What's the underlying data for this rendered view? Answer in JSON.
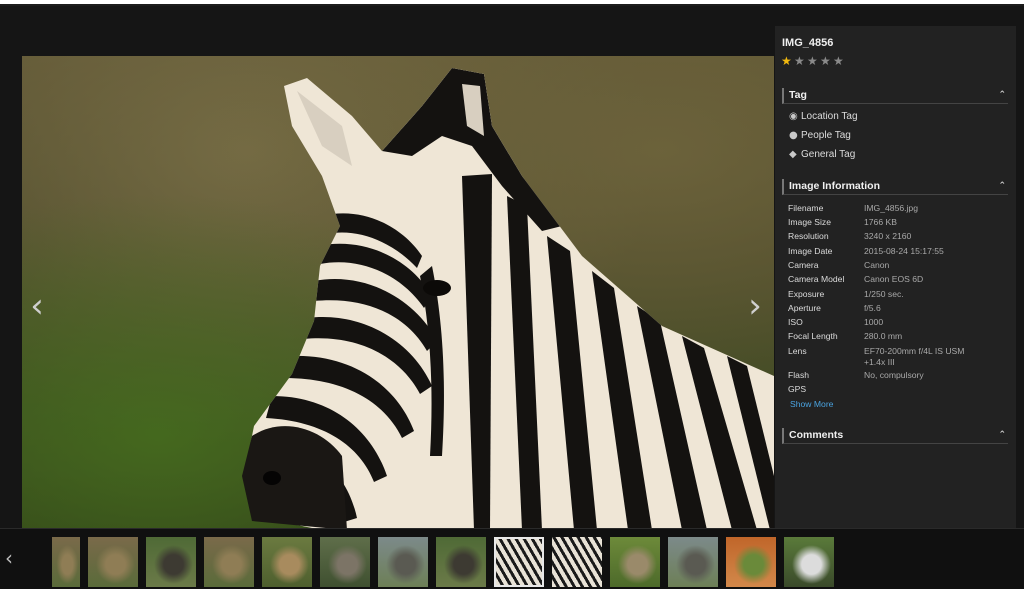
{
  "viewer": {
    "title": "IMG_4856",
    "rating": 1,
    "rating_max": 5
  },
  "tag_section": {
    "heading": "Tag",
    "items": [
      {
        "label": "Location Tag",
        "icon": "location-pin-icon"
      },
      {
        "label": "People Tag",
        "icon": "person-icon"
      },
      {
        "label": "General Tag",
        "icon": "tag-icon"
      }
    ]
  },
  "info_section": {
    "heading": "Image Information",
    "rows": [
      {
        "key": "Filename",
        "value": "IMG_4856.jpg"
      },
      {
        "key": "Image Size",
        "value": "1766 KB"
      },
      {
        "key": "Resolution",
        "value": "3240 x 2160"
      },
      {
        "key": "Image Date",
        "value": "2015-08-24 15:17:55"
      },
      {
        "key": "Camera",
        "value": "Canon"
      },
      {
        "key": "Camera Model",
        "value": "Canon EOS 6D"
      },
      {
        "key": "Exposure",
        "value": "1/250 sec."
      },
      {
        "key": "Aperture",
        "value": "f/5.6"
      },
      {
        "key": "ISO",
        "value": "1000"
      },
      {
        "key": "Focal Length",
        "value": "280.0 mm"
      },
      {
        "key": "Lens",
        "value": "EF70-200mm f/4L IS USM +1.4x III"
      },
      {
        "key": "Flash",
        "value": "No, compulsory"
      },
      {
        "key": "GPS",
        "value": ""
      }
    ],
    "show_more": "Show More"
  },
  "comments_section": {
    "heading": "Comments"
  },
  "icons": {
    "collapse": "chevron-up-icon",
    "prev": "chevron-left-icon",
    "next": "chevron-right-icon",
    "star": "star-icon"
  },
  "colors": {
    "star_on": "#f2b90f",
    "star_off": "#8a8a8a",
    "link": "#4aa3e0",
    "panel_bg": "#222222"
  },
  "filmstrip": {
    "selected_index": 8,
    "thumbs": [
      {
        "subject": "lion"
      },
      {
        "subject": "lion"
      },
      {
        "subject": "buffalo"
      },
      {
        "subject": "lion"
      },
      {
        "subject": "antelope"
      },
      {
        "subject": "rhino"
      },
      {
        "subject": "elephant"
      },
      {
        "subject": "buffalo"
      },
      {
        "subject": "zebra"
      },
      {
        "subject": "zebra"
      },
      {
        "subject": "kudu"
      },
      {
        "subject": "elephant"
      },
      {
        "subject": "dirt-road"
      },
      {
        "subject": "vehicles"
      }
    ]
  }
}
